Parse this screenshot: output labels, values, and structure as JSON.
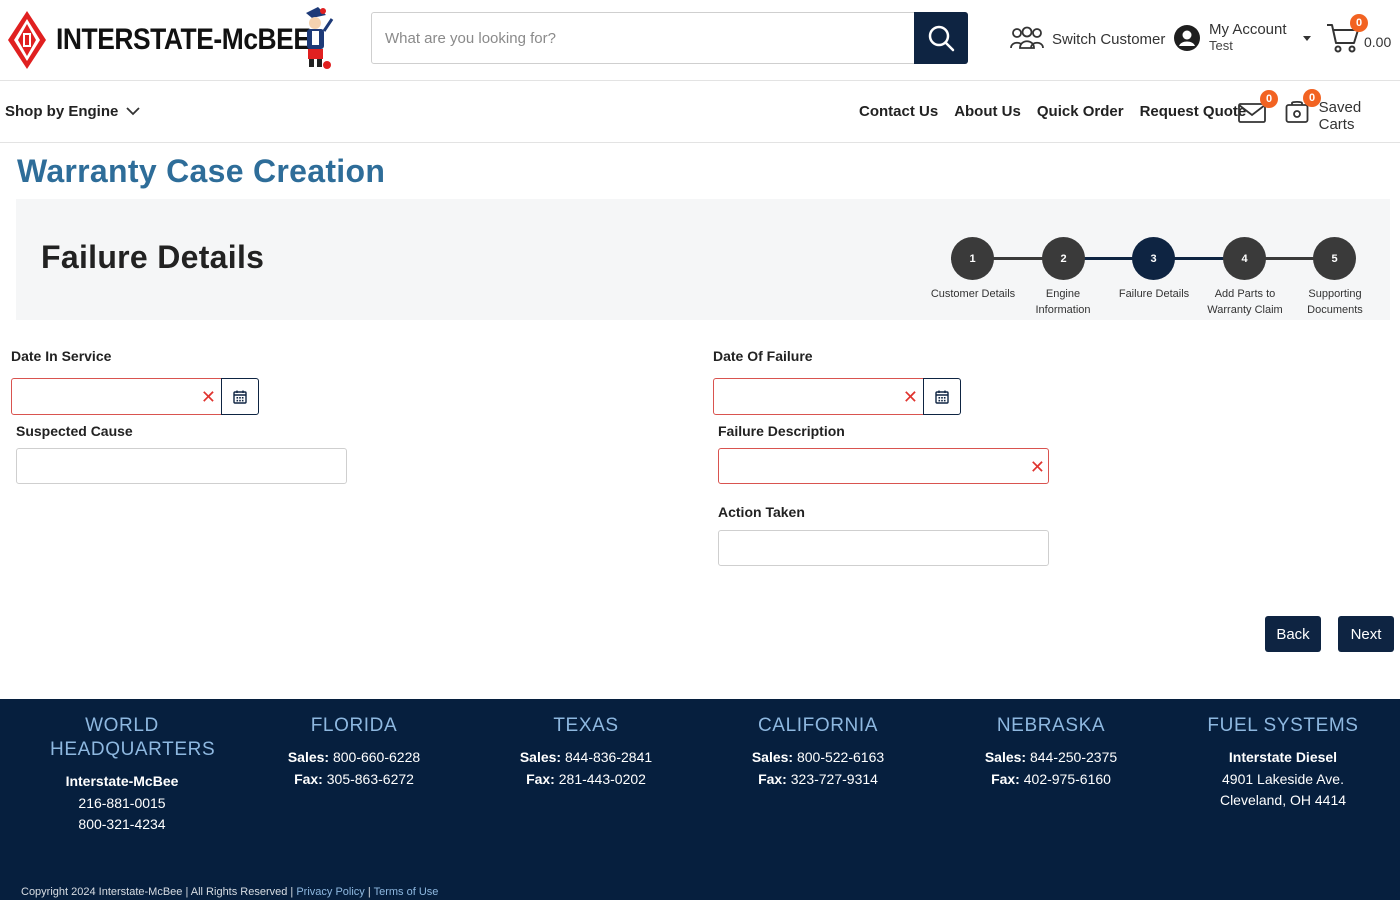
{
  "brand": {
    "name": "INTERSTATE-McBEE",
    "colors": {
      "primary": "#0e2442",
      "title": "#2e6d99",
      "logo_red": "#e02020",
      "badge": "#f26322",
      "error": "#d9534f",
      "footer": "#061f3e",
      "footer_heading": "#8eb8e0"
    }
  },
  "header": {
    "search_placeholder": "What are you looking for?",
    "switch_customer": "Switch Customer",
    "account_label": "My Account",
    "account_user": "Test",
    "cart_count": "0",
    "cart_total": "0.00"
  },
  "nav": {
    "shop_by_engine": "Shop by Engine",
    "links": [
      "Contact Us",
      "About Us",
      "Quick Order",
      "Request Quote"
    ],
    "mail_count": "0",
    "saved_count": "0",
    "saved_carts": "Saved Carts"
  },
  "page": {
    "title": "Warranty Case Creation",
    "section_title": "Failure Details"
  },
  "stepper": {
    "active_step": 3,
    "steps": [
      {
        "number": "1",
        "label": "Customer Details"
      },
      {
        "number": "2",
        "label": "Engine Information"
      },
      {
        "number": "3",
        "label": "Failure Details"
      },
      {
        "number": "4",
        "label": "Add Parts to Warranty Claim"
      },
      {
        "number": "5",
        "label": "Supporting Documents"
      }
    ]
  },
  "form": {
    "date_in_service": {
      "label": "Date In Service",
      "value": ""
    },
    "date_of_failure": {
      "label": "Date Of Failure",
      "value": ""
    },
    "suspected_cause": {
      "label": "Suspected Cause",
      "value": ""
    },
    "failure_description": {
      "label": "Failure Description",
      "value": ""
    },
    "action_taken": {
      "label": "Action Taken",
      "value": ""
    },
    "clear_symbol": "✕"
  },
  "buttons": {
    "back": "Back",
    "next": "Next"
  },
  "footer": {
    "locations": [
      {
        "heading": "WORLD HEADQUARTERS",
        "lines": [
          {
            "bold": "Interstate-McBee",
            "text": ""
          },
          {
            "bold": "",
            "text": "216-881-0015"
          },
          {
            "bold": "",
            "text": "800-321-4234"
          }
        ]
      },
      {
        "heading": "FLORIDA",
        "lines": [
          {
            "bold": "Sales:",
            "text": " 800-660-6228"
          },
          {
            "bold": "Fax:",
            "text": " 305-863-6272"
          }
        ]
      },
      {
        "heading": "TEXAS",
        "lines": [
          {
            "bold": "Sales:",
            "text": " 844-836-2841"
          },
          {
            "bold": "Fax:",
            "text": " 281-443-0202"
          }
        ]
      },
      {
        "heading": "CALIFORNIA",
        "lines": [
          {
            "bold": "Sales:",
            "text": " 800-522-6163"
          },
          {
            "bold": "Fax:",
            "text": " 323-727-9314"
          }
        ]
      },
      {
        "heading": "NEBRASKA",
        "lines": [
          {
            "bold": "Sales:",
            "text": " 844-250-2375"
          },
          {
            "bold": "Fax:",
            "text": " 402-975-6160"
          }
        ]
      },
      {
        "heading": "FUEL SYSTEMS",
        "lines": [
          {
            "bold": "Interstate Diesel",
            "text": ""
          },
          {
            "bold": "",
            "text": "4901 Lakeside Ave."
          },
          {
            "bold": "",
            "text": "Cleveland, OH 4414"
          }
        ]
      }
    ],
    "copyright": "Copyright 2024 Interstate-McBee | All Rights Reserved | ",
    "privacy": "Privacy Policy",
    "separator": " | ",
    "terms": "Terms of Use"
  }
}
